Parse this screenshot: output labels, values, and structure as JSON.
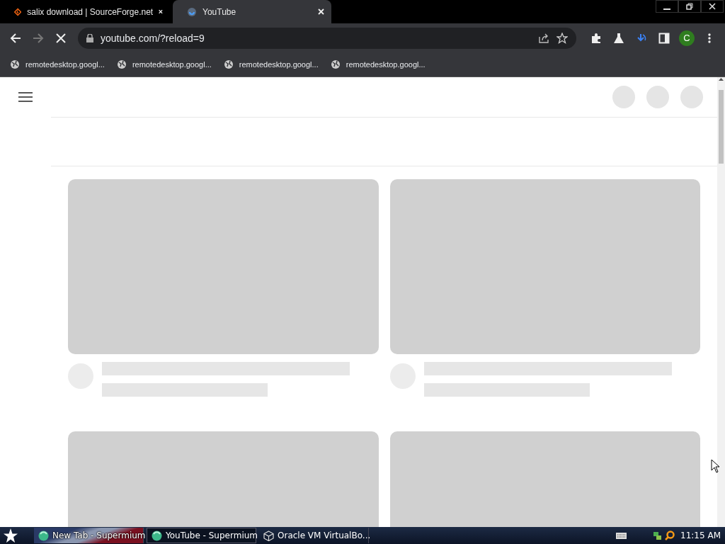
{
  "tabs": [
    {
      "title": "salix download | SourceForge.net",
      "kind": "sourceforge",
      "selected": false
    },
    {
      "title": "YouTube",
      "kind": "youtube",
      "selected": true
    }
  ],
  "toolbar": {
    "url": "youtube.com/?reload=9",
    "loading": true,
    "profile_initial": "C"
  },
  "bookmarks": [
    "remotedesktop.googl...",
    "remotedesktop.googl...",
    "remotedesktop.googl...",
    "remotedesktop.googl..."
  ],
  "taskbar": {
    "buttons": [
      {
        "label": "New Tab - Supermium",
        "kind": "browser",
        "selected": false
      },
      {
        "label": "YouTube - Supermium",
        "kind": "browser",
        "selected": true
      },
      {
        "label": "Oracle VM VirtualBo...",
        "kind": "virtualbox",
        "selected": false
      }
    ],
    "clock": "11:15 AM"
  }
}
